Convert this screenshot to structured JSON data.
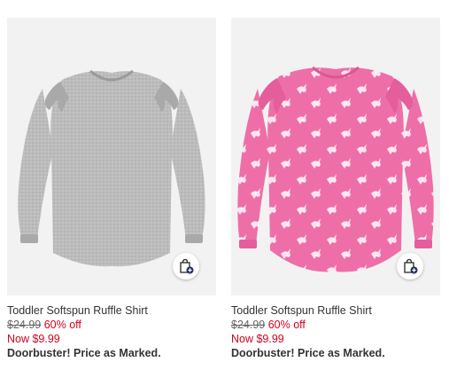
{
  "products": [
    {
      "title": "Toddler Softspun Ruffle Shirt",
      "old_price": "$24.99",
      "discount": "60% off",
      "now_price": "Now $9.99",
      "promo": "Doorbuster! Price as Marked.",
      "shirt_color": "#b9b9b9",
      "pattern": "none"
    },
    {
      "title": "Toddler Softspun Ruffle Shirt",
      "old_price": "$24.99",
      "discount": "60% off",
      "now_price": "Now $9.99",
      "promo": "Doorbuster! Price as Marked.",
      "shirt_color": "#ee6fa8",
      "pattern": "unicorn print"
    }
  ],
  "icons": {
    "bag": "shopping-bag-add-icon"
  },
  "colors": {
    "sale_red": "#d0021b",
    "tile_bg": "#f2f2f2"
  }
}
